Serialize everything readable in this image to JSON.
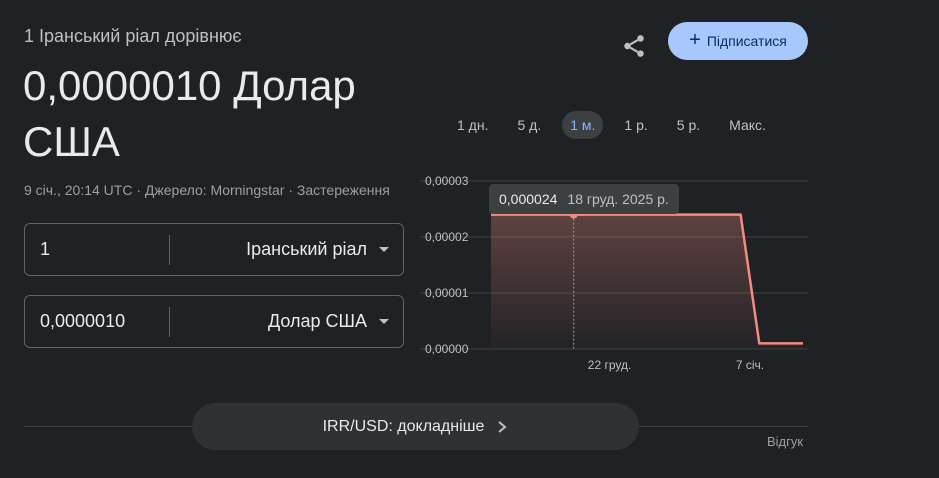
{
  "header": {
    "subtitle": "1 Іранський ріал дорівнює",
    "result": "0,0000010 Долар США",
    "timestamp": "9 січ., 20:14 UTC",
    "source": "Джерело: Morningstar",
    "disclaimer": "Застереження",
    "separator": "·"
  },
  "actions": {
    "share_icon": "share-icon",
    "follow_icon": "plus-icon",
    "follow_plus": "+",
    "follow_label": "Підписатися"
  },
  "converter": {
    "from": {
      "value": "1",
      "currency": "Іранський ріал"
    },
    "to": {
      "value": "0,0000010",
      "currency": "Долар США"
    }
  },
  "ranges": [
    {
      "label": "1 дн.",
      "active": false
    },
    {
      "label": "5 д.",
      "active": false
    },
    {
      "label": "1 м.",
      "active": true
    },
    {
      "label": "1 р.",
      "active": false
    },
    {
      "label": "5 р.",
      "active": false
    },
    {
      "label": "Макс.",
      "active": false
    }
  ],
  "tooltip": {
    "value": "0,000024",
    "date": "18 груд. 2025 р."
  },
  "chart_data": {
    "type": "area",
    "y_ticks": [
      "0,00003",
      "0,00002",
      "0,00001",
      "0,00000"
    ],
    "x_ticks": [
      {
        "label": "22 груд.",
        "x": 0.38
      },
      {
        "label": "7 січ.",
        "x": 0.83
      }
    ],
    "ylim": [
      0,
      3e-05
    ],
    "x": [
      0,
      0.07,
      0.15,
      0.25,
      0.35,
      0.45,
      0.55,
      0.65,
      0.75,
      0.8,
      0.86,
      0.9,
      1.0
    ],
    "values": [
      2.4e-05,
      2.4e-05,
      2.4e-05,
      2.4e-05,
      2.4e-05,
      2.4e-05,
      2.4e-05,
      2.4e-05,
      2.4e-05,
      2.4e-05,
      1e-06,
      1e-06,
      1e-06
    ],
    "highlight_x": 0.265,
    "grid": true,
    "line_color": "#f28b82"
  },
  "footer": {
    "more_label": "IRR/USD: докладніше",
    "more_icon": "chevron-right-icon",
    "feedback": "Відгук"
  }
}
